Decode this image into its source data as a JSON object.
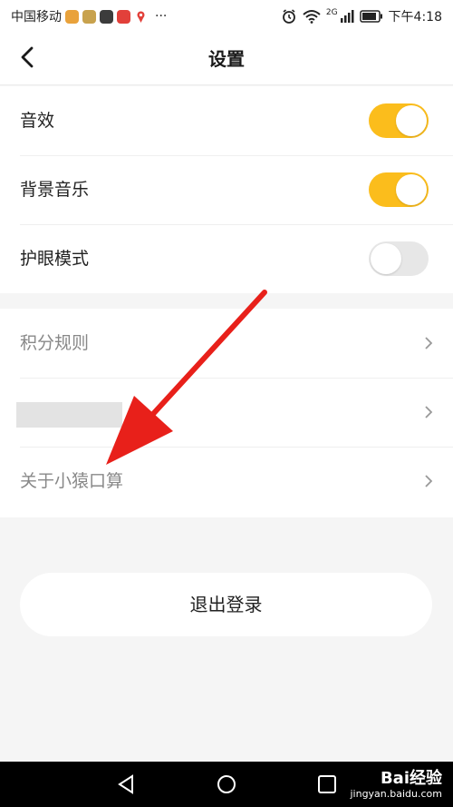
{
  "status_bar": {
    "carrier": "中国移动",
    "time": "下午4:18",
    "network": "2G",
    "more": "···"
  },
  "header": {
    "title": "设置"
  },
  "toggles": [
    {
      "label": "音效",
      "on": true
    },
    {
      "label": "背景音乐",
      "on": true
    },
    {
      "label": "护眼模式",
      "on": false
    }
  ],
  "links": [
    {
      "label": "积分规则"
    },
    {
      "label": ""
    },
    {
      "label": "关于小猿口算"
    }
  ],
  "logout_label": "退出登录",
  "watermark": {
    "brand": "Bai经验",
    "site": "jingyan.baidu.com"
  },
  "colors": {
    "toggle_on": "#fbbd1c",
    "toggle_off": "#e7e7e7",
    "annotation_arrow": "#e8201a"
  }
}
